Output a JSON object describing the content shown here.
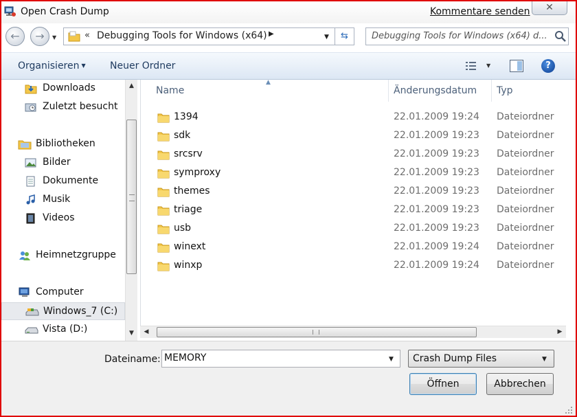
{
  "window": {
    "title": "Open Crash Dump",
    "feedback_link": "Kommentare senden",
    "close_glyph": "✕"
  },
  "navigation": {
    "address_prefix": "«",
    "address_crumb": "Debugging Tools for Windows (x64)",
    "search_placeholder": "Debugging Tools for Windows (x64) d..."
  },
  "toolbar": {
    "organize_label": "Organisieren",
    "new_folder_label": "Neuer Ordner"
  },
  "sidebar": {
    "items": [
      {
        "label": "Downloads",
        "icon": "downloads-folder-icon",
        "selected": false,
        "header": false
      },
      {
        "label": "Zuletzt besucht",
        "icon": "recent-places-icon",
        "selected": false,
        "header": false
      },
      {
        "label": "Bibliotheken",
        "icon": "libraries-icon",
        "selected": false,
        "header": true
      },
      {
        "label": "Bilder",
        "icon": "pictures-icon",
        "selected": false,
        "header": false
      },
      {
        "label": "Dokumente",
        "icon": "documents-icon",
        "selected": false,
        "header": false
      },
      {
        "label": "Musik",
        "icon": "music-icon",
        "selected": false,
        "header": false
      },
      {
        "label": "Videos",
        "icon": "videos-icon",
        "selected": false,
        "header": false
      },
      {
        "label": "Heimnetzgruppe",
        "icon": "homegroup-icon",
        "selected": false,
        "header": true
      },
      {
        "label": "Computer",
        "icon": "computer-icon",
        "selected": false,
        "header": true
      },
      {
        "label": "Windows_7 (C:)",
        "icon": "drive-icon",
        "selected": true,
        "header": false
      },
      {
        "label": "Vista (D:)",
        "icon": "drive-icon",
        "selected": false,
        "header": false
      }
    ]
  },
  "file_list": {
    "columns": [
      "Name",
      "Änderungsdatum",
      "Typ"
    ],
    "rows": [
      {
        "name": "1394",
        "date": "22.01.2009 19:24",
        "type": "Dateiordner"
      },
      {
        "name": "sdk",
        "date": "22.01.2009 19:23",
        "type": "Dateiordner"
      },
      {
        "name": "srcsrv",
        "date": "22.01.2009 19:23",
        "type": "Dateiordner"
      },
      {
        "name": "symproxy",
        "date": "22.01.2009 19:23",
        "type": "Dateiordner"
      },
      {
        "name": "themes",
        "date": "22.01.2009 19:23",
        "type": "Dateiordner"
      },
      {
        "name": "triage",
        "date": "22.01.2009 19:23",
        "type": "Dateiordner"
      },
      {
        "name": "usb",
        "date": "22.01.2009 19:23",
        "type": "Dateiordner"
      },
      {
        "name": "winext",
        "date": "22.01.2009 19:24",
        "type": "Dateiordner"
      },
      {
        "name": "winxp",
        "date": "22.01.2009 19:24",
        "type": "Dateiordner"
      }
    ]
  },
  "footer": {
    "filename_label": "Dateiname:",
    "filename_value": "MEMORY",
    "filetype_value": "Crash Dump Files",
    "open_label": "Öffnen",
    "cancel_label": "Abbrechen"
  },
  "colors": {
    "accent_border": "#e00000",
    "toolbar_text": "#1e3a5f",
    "folder_yellow": "#f3c74a"
  }
}
